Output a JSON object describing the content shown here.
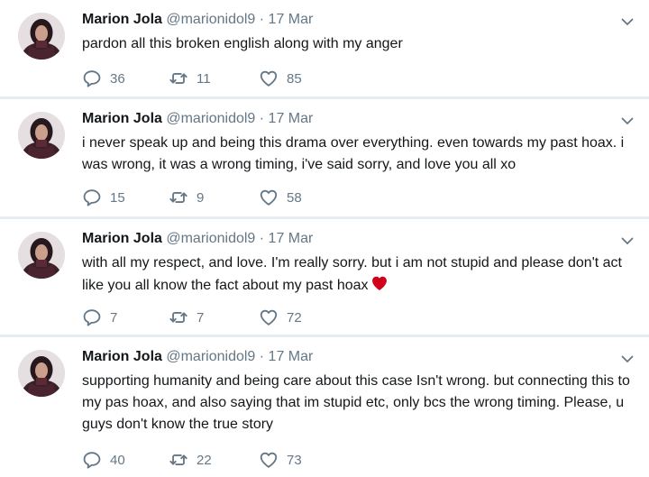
{
  "author": {
    "name": "Marion Jola",
    "handle": "@marionidol9"
  },
  "tweets": [
    {
      "date": "17 Mar",
      "text": "pardon all this broken english along with my anger",
      "replies": "36",
      "retweets": "11",
      "likes": "85"
    },
    {
      "date": "17 Mar",
      "text": "i never speak up and being this drama over everything.  even towards my past hoax.  i was wrong, it was a wrong timing, i've said sorry, and love you all xo",
      "replies": "15",
      "retweets": "9",
      "likes": "58"
    },
    {
      "date": "17 Mar",
      "text": "with all my respect, and love. I'm really sorry. but i am not stupid and please don't act like you all know the fact about my past hoax",
      "emoji": "red-heart-icon",
      "replies": "7",
      "retweets": "7",
      "likes": "72"
    },
    {
      "date": "17 Mar",
      "text": "supporting humanity and being care about this case Isn't wrong. but connecting this to my pas hoax, and also saying that im stupid etc, only bcs the wrong timing. Please, u guys don't know the true story",
      "replies": "40",
      "retweets": "22",
      "likes": "73"
    }
  ],
  "colors": {
    "muted": "#657786",
    "text": "#14171a",
    "divider": "#e6ecf0",
    "heart_emoji": "#d0021b"
  }
}
